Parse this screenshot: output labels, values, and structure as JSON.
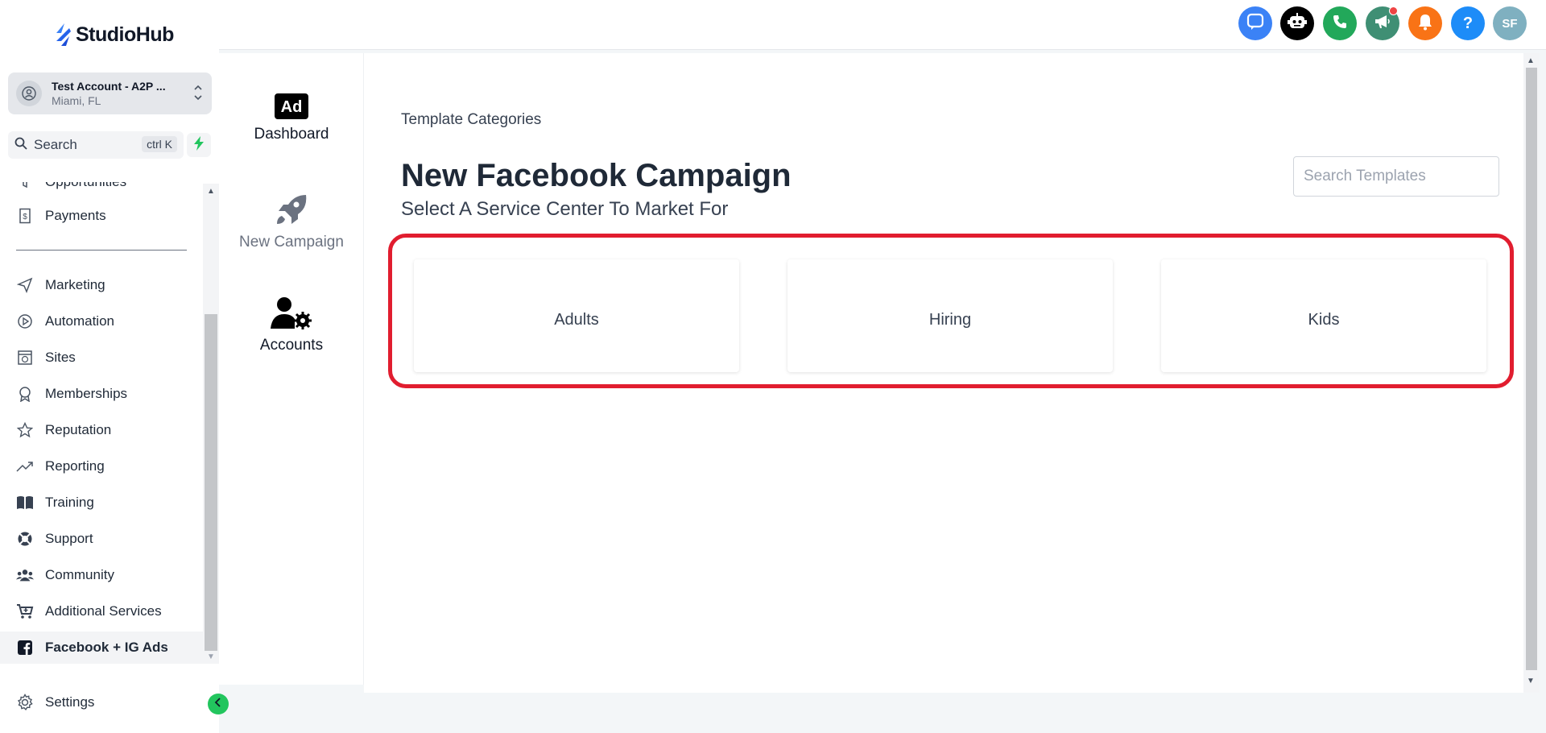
{
  "brand": {
    "name": "StudioHub"
  },
  "account": {
    "name": "Test Account - A2P ...",
    "location": "Miami, FL"
  },
  "search": {
    "label": "Search",
    "shortcut": "ctrl K"
  },
  "sidebar": {
    "items": [
      {
        "label": "Opportunities",
        "icon": "funnel-icon"
      },
      {
        "label": "Payments",
        "icon": "invoice-icon"
      },
      {
        "label": "Marketing",
        "icon": "send-icon"
      },
      {
        "label": "Automation",
        "icon": "automation-icon"
      },
      {
        "label": "Sites",
        "icon": "globe-window-icon"
      },
      {
        "label": "Memberships",
        "icon": "badge-icon"
      },
      {
        "label": "Reputation",
        "icon": "star-icon"
      },
      {
        "label": "Reporting",
        "icon": "trend-icon"
      },
      {
        "label": "Training",
        "icon": "book-icon"
      },
      {
        "label": "Support",
        "icon": "lifebuoy-icon"
      },
      {
        "label": "Community",
        "icon": "users-icon"
      },
      {
        "label": "Additional Services",
        "icon": "cart-icon"
      },
      {
        "label": "Facebook + IG Ads",
        "icon": "facebook-icon",
        "active": true
      }
    ],
    "settings": "Settings"
  },
  "topbar": {
    "icons": [
      "chat-icon",
      "bot-icon",
      "phone-icon",
      "megaphone-icon",
      "bell-icon",
      "help-icon"
    ],
    "avatar_initials": "SF",
    "colors": {
      "chat": "#3b82f6",
      "bot": "#000000",
      "phone": "#22a85a",
      "megaphone": "#3f8f74",
      "bell": "#f97316",
      "help": "#1d8cf8",
      "avatar": "#7fb0c0"
    }
  },
  "iconcol": {
    "items": [
      {
        "label": "Dashboard",
        "icon": "ad-icon"
      },
      {
        "label": "New Campaign",
        "icon": "rocket-icon"
      },
      {
        "label": "Accounts",
        "icon": "user-gear-icon"
      }
    ]
  },
  "main": {
    "breadcrumb": "Template Categories",
    "title": "New Facebook Campaign",
    "subtitle": "Select A Service Center To Market For",
    "search_placeholder": "Search Templates",
    "cards": [
      "Adults",
      "Hiring",
      "Kids"
    ],
    "highlight_color": "#e11d2f"
  }
}
